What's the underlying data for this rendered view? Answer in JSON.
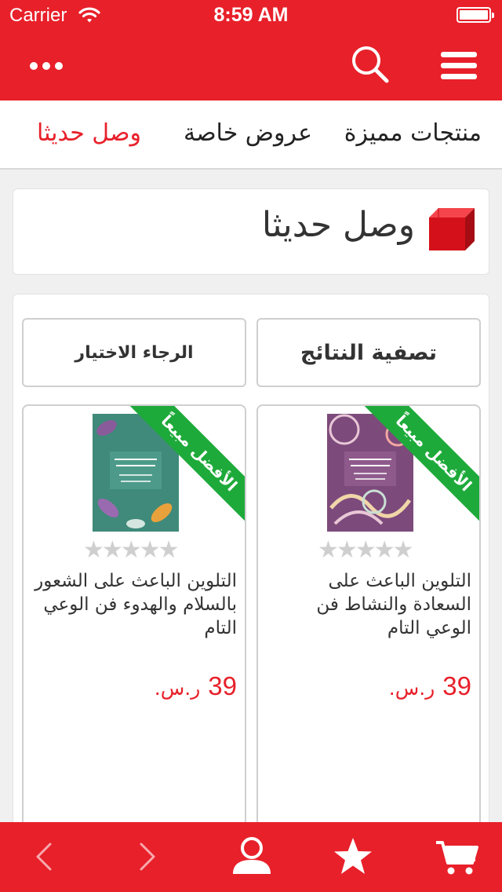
{
  "status_bar": {
    "carrier": "Carrier",
    "time": "8:59 AM",
    "battery_level": 1.0
  },
  "nav_bar": {
    "icons": [
      "more-dots-icon",
      "search-icon",
      "hamburger-menu-icon"
    ]
  },
  "tabs": [
    {
      "label": "منتجات مميزة",
      "active": false
    },
    {
      "label": "عروض خاصة",
      "active": false
    },
    {
      "label": "وصل حديثا",
      "active": true
    }
  ],
  "section": {
    "title": "وصل حديثا",
    "icon": "red-cube-icon"
  },
  "controls": {
    "filter_label": "تصفية النتائج",
    "select_label": "الرجاء الاختيار"
  },
  "products": [
    {
      "name": "التلوين الباعث على السعادة والنشاط فن الوعي التام",
      "ribbon": "الأفضل مبيعاً",
      "rating": 0,
      "max_rating": 5,
      "price": "39",
      "currency": "ر.س."
    },
    {
      "name": "التلوين الباعث على الشعور بالسلام والهدوء فن الوعي التام",
      "ribbon": "الأفضل مبيعاً",
      "rating": 0,
      "max_rating": 5,
      "price": "39",
      "currency": "ر.س."
    }
  ],
  "bottom_bar": {
    "icons": [
      "back-arrow-icon",
      "forward-arrow-icon",
      "user-icon",
      "star-icon",
      "cart-icon"
    ]
  },
  "colors": {
    "brand_red": "#e8202a",
    "ribbon_green": "#1eaa3a",
    "star_empty": "#cfcfcf"
  }
}
